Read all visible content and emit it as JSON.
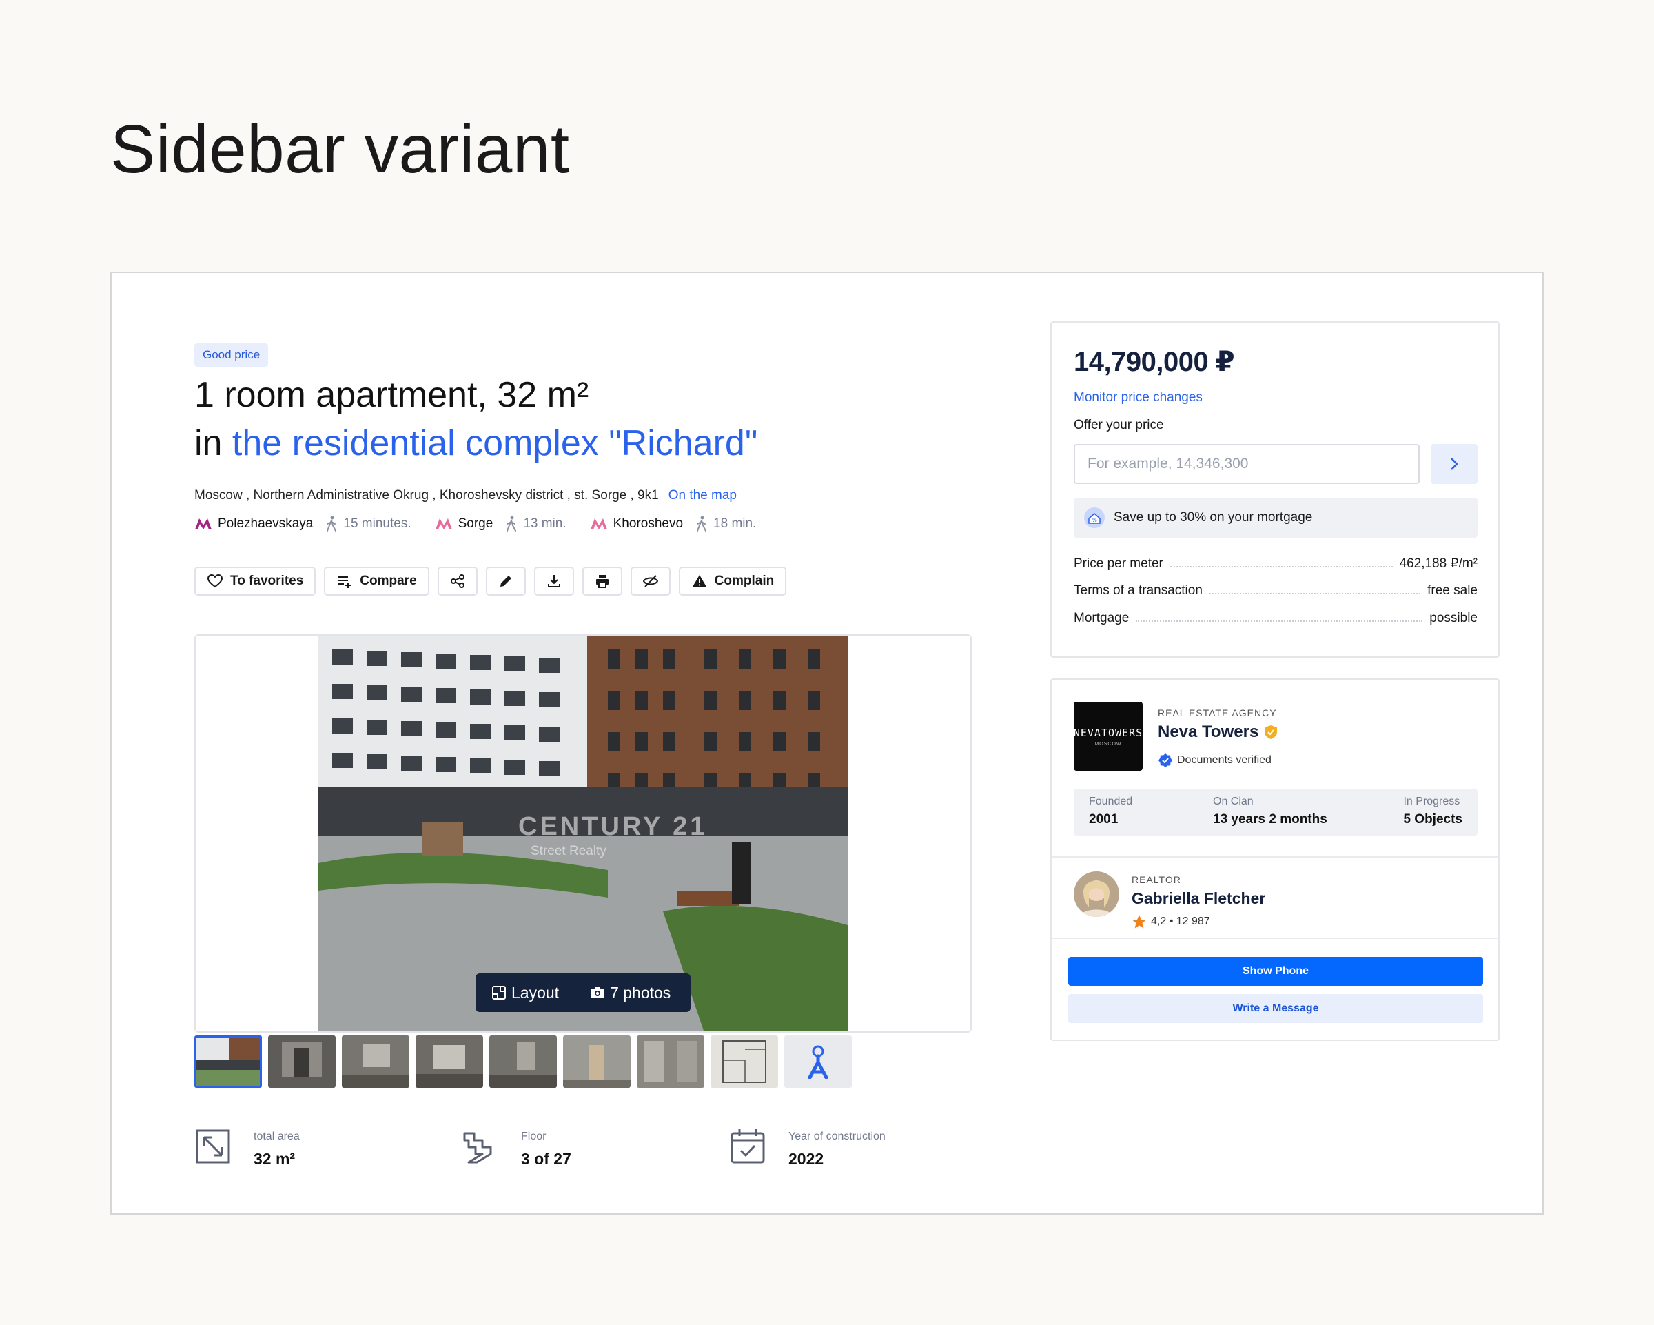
{
  "page": {
    "heading": "Sidebar variant"
  },
  "listing": {
    "badge": "Good price",
    "title_line1": "1 room apartment, 32 m²",
    "title_prefix": "in ",
    "title_link": "the residential complex \"Richard\"",
    "address": "Moscow , Northern Administrative Okrug , Khoroshevsky district , st. Sorge , 9k1",
    "map_link": "On the map",
    "metros": [
      {
        "name": "Polezhaevskaya",
        "time": "15 minutes."
      },
      {
        "name": "Sorge",
        "time": "13 min."
      },
      {
        "name": "Khoroshevo",
        "time": "18 min."
      }
    ],
    "metro_color": "#a52380"
  },
  "actions": {
    "favorites": "To favorites",
    "compare": "Compare",
    "share_icon": "share-icon",
    "edit_icon": "pencil-icon",
    "download_icon": "download-icon",
    "print_icon": "print-icon",
    "hide_icon": "hide-icon",
    "complain": "Complain"
  },
  "gallery": {
    "watermark": "CENTURY 21",
    "watermark_sub": "Street Realty",
    "layout_label": "Layout",
    "photos_label": "7 photos",
    "thumbnails": [
      "courtyard",
      "entrance",
      "room-1",
      "room-2",
      "room-3",
      "hallway",
      "bathroom",
      "floor-plan",
      "map"
    ]
  },
  "facts": [
    {
      "label": "total area",
      "value": "32 m²",
      "icon": "area-icon"
    },
    {
      "label": "Floor",
      "value": "3 of 27",
      "icon": "stairs-icon"
    },
    {
      "label": "Year of construction",
      "value": "2022",
      "icon": "calendar-icon"
    }
  ],
  "pricing": {
    "price": "14,790,000 ₽",
    "monitor": "Monitor price changes",
    "offer_label": "Offer your price",
    "offer_placeholder": "For example, 14,346,300",
    "offer_value": "",
    "mortgage_promo": "Save up to 30% on your mortgage",
    "details": [
      {
        "key": "Price per meter",
        "value": "462,188 ₽/m²"
      },
      {
        "key": "Terms of a transaction",
        "value": "free sale"
      },
      {
        "key": "Mortgage",
        "value": "possible"
      }
    ]
  },
  "agency": {
    "logo_text": "NEVATOWERS",
    "logo_sub": "MOSCOW",
    "type": "REAL ESTATE AGENCY",
    "name": "Neva Towers",
    "verified": "Documents verified",
    "stats": [
      {
        "label": "Founded",
        "value": "2001"
      },
      {
        "label": "On Cian",
        "value": "13 years 2 months"
      },
      {
        "label": "In Progress",
        "value": "5 Objects"
      }
    ]
  },
  "realtor": {
    "type": "REALTOR",
    "name": "Gabriella Fletcher",
    "rating": "4,2 • 12 987",
    "show_phone": "Show Phone",
    "write_message": "Write a Message"
  },
  "colors": {
    "accent": "#2a62ec",
    "primary_button": "#0468ff",
    "dark": "#15213d"
  }
}
